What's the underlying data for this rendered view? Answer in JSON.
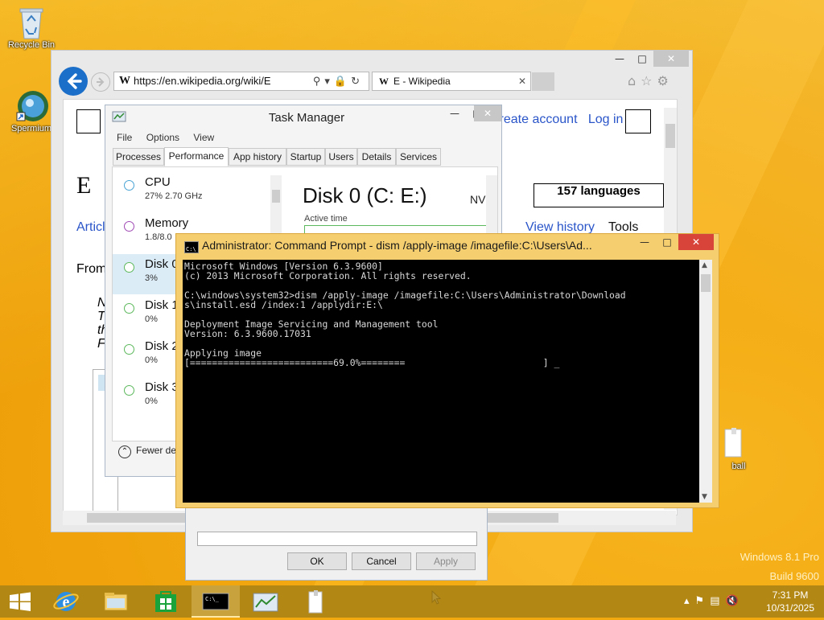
{
  "desktop": {
    "icons": [
      {
        "label": "Recycle Bin"
      },
      {
        "label": "Spermium"
      },
      {
        "label": "ball"
      }
    ],
    "watermark_line1": "Windows 8.1 Pro",
    "watermark_line2": "Build 9600"
  },
  "ie": {
    "url": "https://en.wikipedia.org/wiki/E",
    "tab_title": "E - Wikipedia",
    "page": {
      "create_account": "Create account",
      "log_in": "Log in",
      "heading": "E",
      "languages_button": "157 languages",
      "article_tab": "Article",
      "view_history": "View history",
      "tools": "Tools",
      "from_text": "From",
      "italic_lines": [
        "N",
        "T",
        "th",
        "F"
      ]
    }
  },
  "task_manager": {
    "title": "Task Manager",
    "menu": [
      "File",
      "Options",
      "View"
    ],
    "tabs": [
      "Processes",
      "Performance",
      "App history",
      "Startup",
      "Users",
      "Details",
      "Services"
    ],
    "active_tab": "Performance",
    "sidebar": [
      {
        "name": "CPU",
        "value": "27%  2.70 GHz",
        "color": "#49a3d4"
      },
      {
        "name": "Memory",
        "value": "1.8/8.0",
        "color": "#a04ab5"
      },
      {
        "name": "Disk 0",
        "value": "3%",
        "color": "#5cb85c"
      },
      {
        "name": "Disk 1",
        "value": "0%",
        "color": "#5cb85c"
      },
      {
        "name": "Disk 2",
        "value": "0%",
        "color": "#5cb85c"
      },
      {
        "name": "Disk 3",
        "value": "0%",
        "color": "#5cb85c"
      }
    ],
    "detail_title": "Disk 0 (C: E:)",
    "detail_model": "NVI",
    "active_time_label": "Active time",
    "fewer_details": "Fewer de"
  },
  "dialog": {
    "ok": "OK",
    "cancel": "Cancel",
    "apply": "Apply"
  },
  "cmd": {
    "title": "Administrator: Command Prompt - dism  /apply-image /imagefile:C:\\Users\\Ad...",
    "lines": [
      "Microsoft Windows [Version 6.3.9600]",
      "(c) 2013 Microsoft Corporation. All rights reserved.",
      "",
      "C:\\windows\\system32>dism /apply-image /imagefile:C:\\Users\\Administrator\\Download",
      "s\\install.esd /index:1 /applydir:E:\\",
      "",
      "Deployment Image Servicing and Management tool",
      "Version: 6.3.9600.17031",
      "",
      "Applying image",
      "[==========================69.0%========                         ] _"
    ],
    "progress_percent": 69.0
  },
  "taskbar": {
    "clock_time": "7:31 PM",
    "clock_date": "10/31/2025",
    "buttons": [
      "start",
      "internet-explorer",
      "file-explorer",
      "store",
      "command-prompt",
      "task-manager",
      "document"
    ]
  }
}
